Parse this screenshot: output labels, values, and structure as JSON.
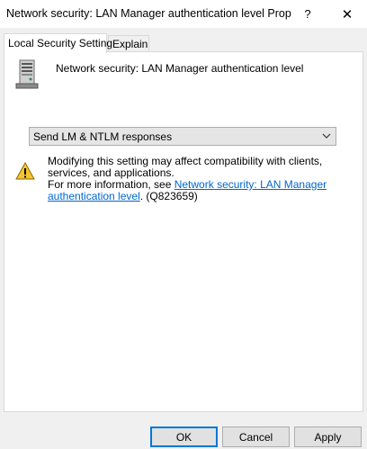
{
  "window": {
    "title": "Network security: LAN Manager authentication level Prop...",
    "help_label": "?",
    "close_label": "✕"
  },
  "tabs": [
    {
      "label": "Local Security Setting",
      "active": true
    },
    {
      "label": "Explain",
      "active": false
    }
  ],
  "policy": {
    "icon": "server-policy-icon",
    "title": "Network security: LAN Manager authentication level"
  },
  "setting": {
    "selected_value": "Send LM & NTLM responses"
  },
  "warning": {
    "icon": "warning-icon",
    "line1": "Modifying this setting may affect compatibility with clients, services, and applications.",
    "more_info_prefix": "For more information, see ",
    "link_text": "Network security: LAN Manager authentication level",
    "more_info_suffix": ". (Q823659)"
  },
  "buttons": {
    "ok": "OK",
    "cancel": "Cancel",
    "apply": "Apply"
  },
  "colors": {
    "link": "#0066cc",
    "default_button_border": "#0078d7",
    "warning_fill": "#f4c430"
  }
}
